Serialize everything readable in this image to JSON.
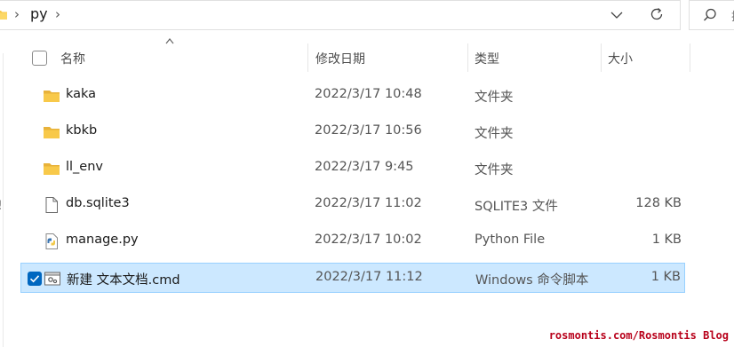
{
  "address_bar": {
    "crumbs": [
      "py"
    ],
    "search_placeholder": "搜"
  },
  "columns": {
    "name": "名称",
    "date": "修改日期",
    "type": "类型",
    "size": "大小"
  },
  "rows": [
    {
      "name": "kaka",
      "date": "2022/3/17 10:48",
      "type": "文件夹",
      "size": "",
      "icon": "folder-icon",
      "selected": false
    },
    {
      "name": "kbkb",
      "date": "2022/3/17 10:56",
      "type": "文件夹",
      "size": "",
      "icon": "folder-icon",
      "selected": false
    },
    {
      "name": "ll_env",
      "date": "2022/3/17 9:45",
      "type": "文件夹",
      "size": "",
      "icon": "folder-icon",
      "selected": false
    },
    {
      "name": "db.sqlite3",
      "date": "2022/3/17 11:02",
      "type": "SQLITE3 文件",
      "size": "128 KB",
      "icon": "file-icon",
      "selected": false
    },
    {
      "name": "manage.py",
      "date": "2022/3/17 10:02",
      "type": "Python File",
      "size": "1 KB",
      "icon": "python-file-icon",
      "selected": false
    },
    {
      "name": "新建 文本文档.cmd",
      "date": "2022/3/17 11:12",
      "type": "Windows 命令脚本",
      "size": "1 KB",
      "icon": "cmd-file-icon",
      "selected": true
    }
  ],
  "colors": {
    "selection_bg": "#cce8ff",
    "selection_border": "#99d1ff",
    "checkbox_accent": "#0067c0",
    "folder_yellow": "#f8c94a",
    "watermark": "#b8001a"
  },
  "watermark": "rosmontis.com/Rosmontis Blog"
}
